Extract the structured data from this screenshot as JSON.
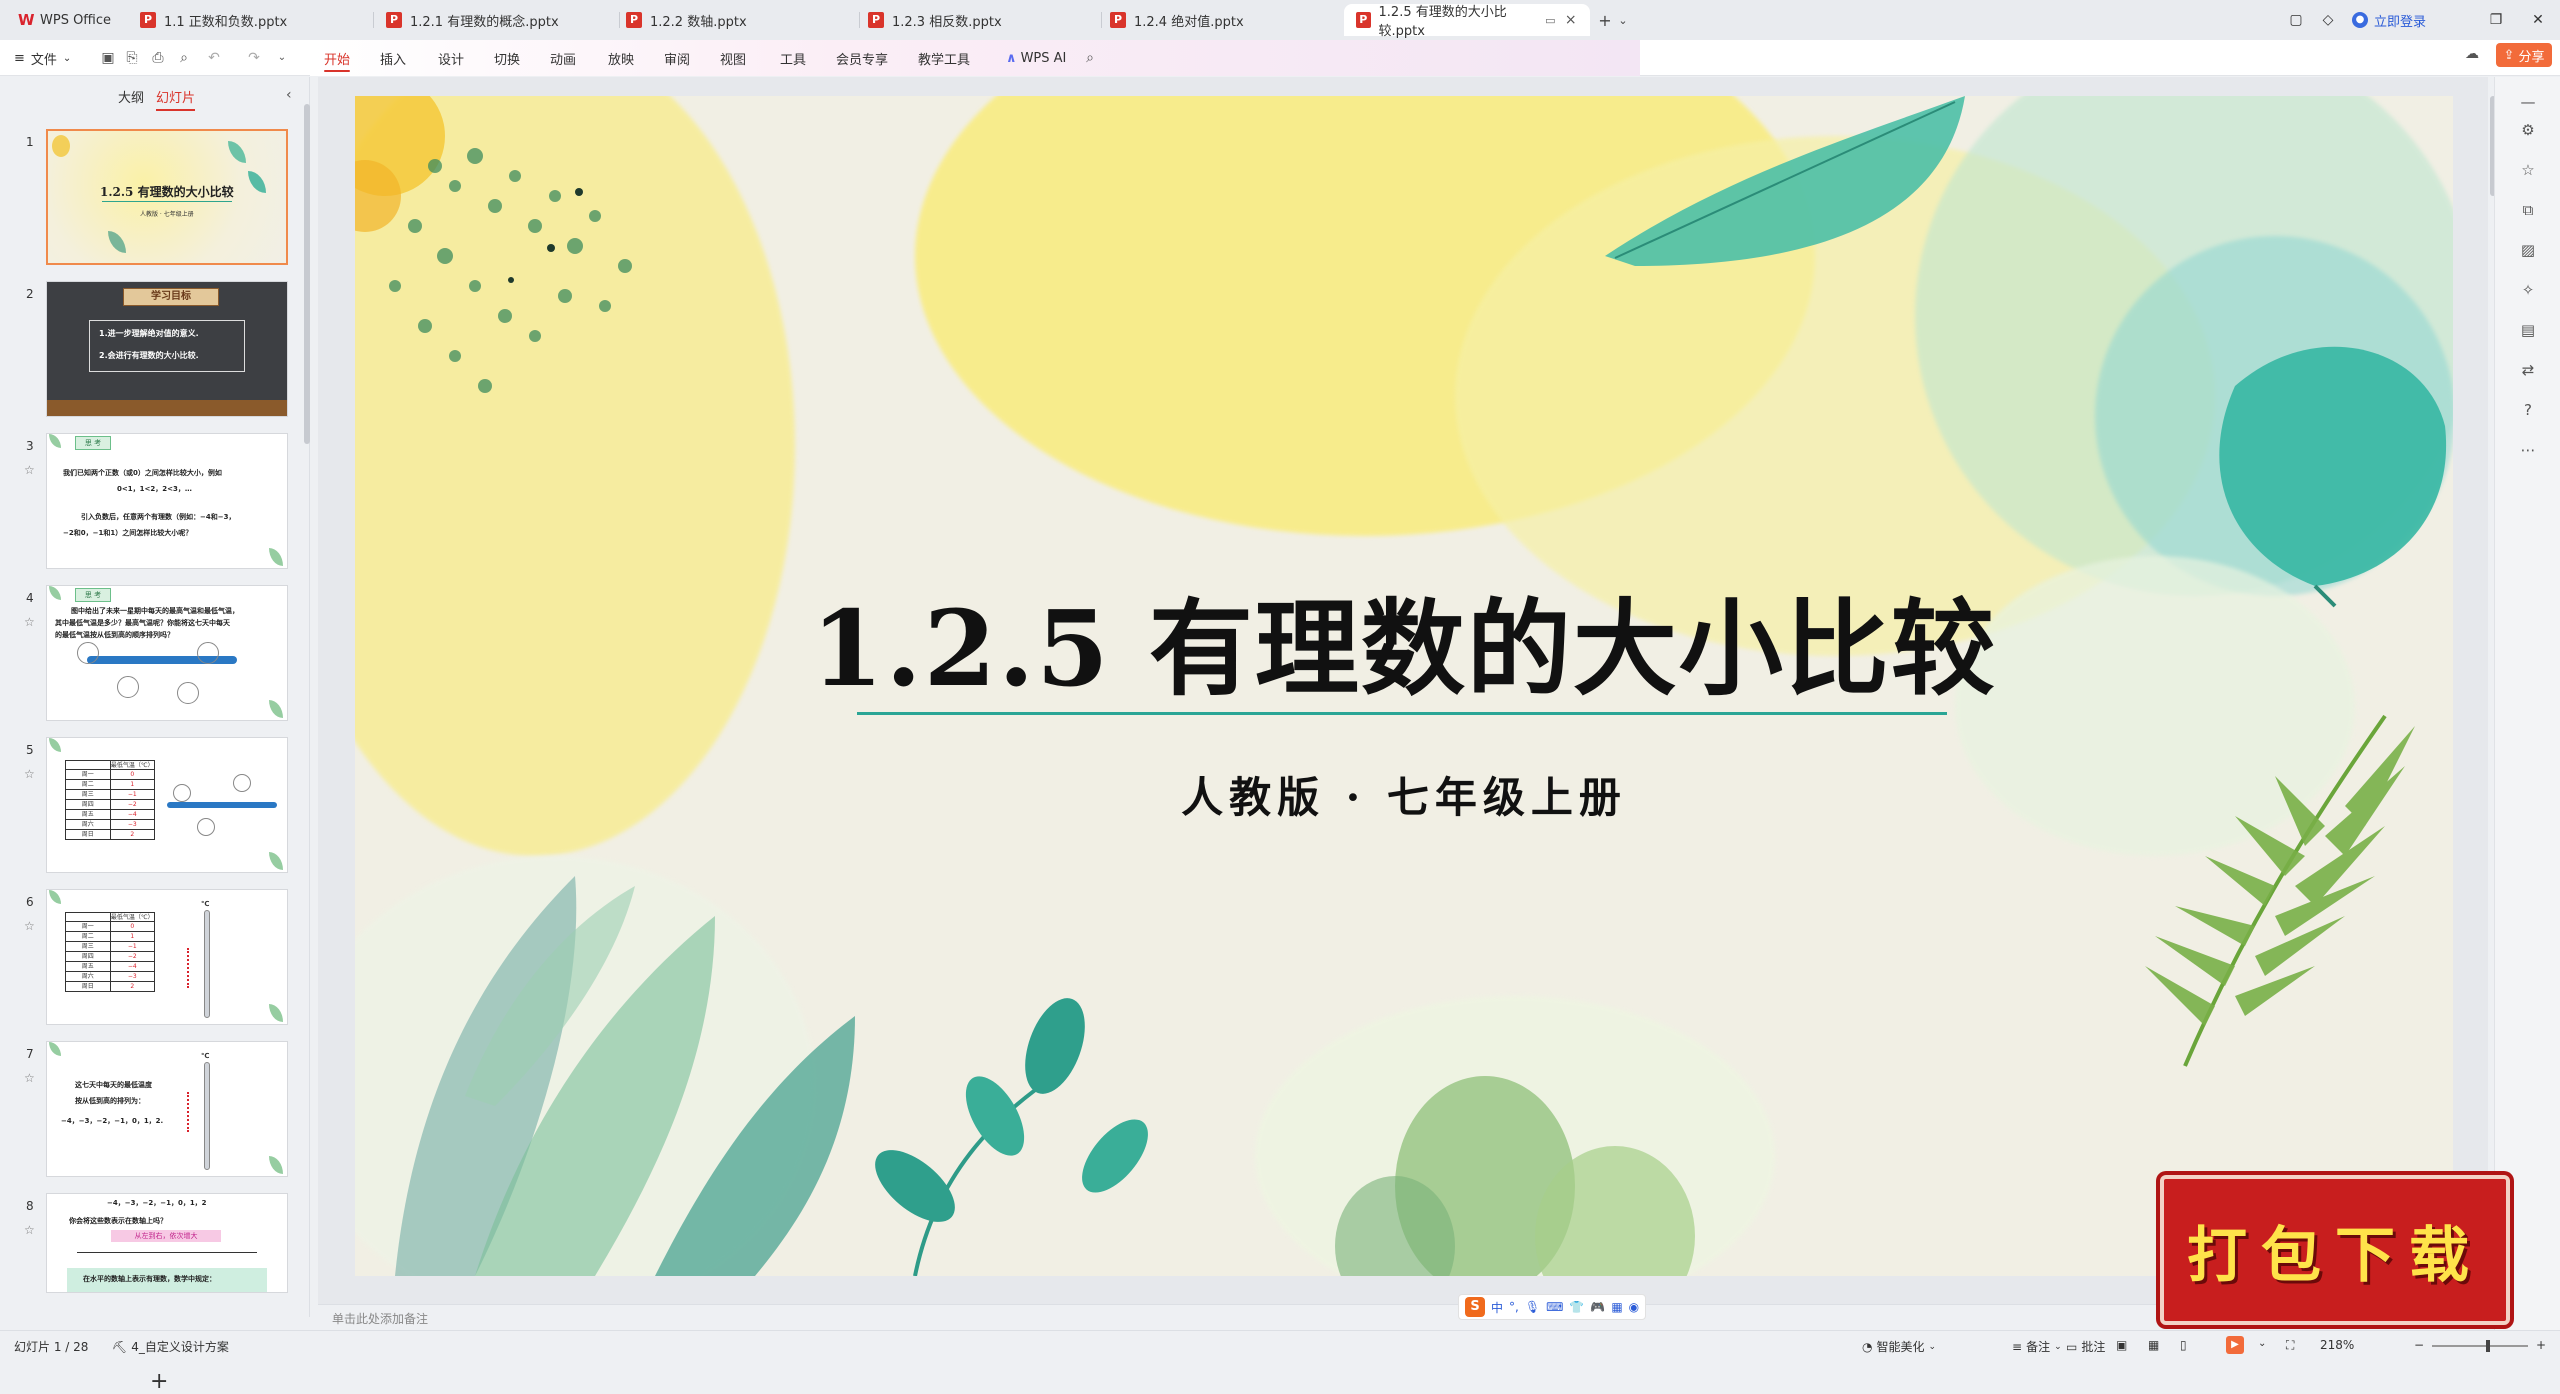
{
  "app": {
    "name": "WPS Office"
  },
  "tabs": [
    {
      "label": "1.1 正数和负数.pptx"
    },
    {
      "label": "1.2.1 有理数的概念.pptx"
    },
    {
      "label": "1.2.2 数轴.pptx"
    },
    {
      "label": "1.2.3 相反数.pptx"
    },
    {
      "label": "1.2.4 绝对值.pptx"
    },
    {
      "label": "1.2.5 有理数的大小比较.pptx",
      "active": true
    }
  ],
  "header": {
    "login_label": "立即登录",
    "share_label": "分享"
  },
  "ribbon": {
    "file_label": "文件",
    "tabs": [
      "开始",
      "插入",
      "设计",
      "切换",
      "动画",
      "放映",
      "审阅",
      "视图",
      "工具",
      "会员专享",
      "教学工具"
    ],
    "wps_ai_label": "WPS AI"
  },
  "left_panel": {
    "tab_outline": "大纲",
    "tab_slides": "幻灯片",
    "thumbnails": [
      {
        "num": "1",
        "title": "1.2.5 有理数的大小比较",
        "sub": "人教版 · 七年级上册"
      },
      {
        "num": "2",
        "header": "学习目标",
        "line1": "1.进一步理解绝对值的意义.",
        "line2": "2.会进行有理数的大小比较."
      },
      {
        "num": "3",
        "label": "思 考",
        "line1": "我们已知两个正数（或0）之间怎样比较大小，例如",
        "line2": "0<1，1<2，2<3，…",
        "line3": "引入负数后，任意两个有理数（例如：−4和−3，",
        "line4": "−2和0，−1和1）之间怎样比较大小呢？"
      },
      {
        "num": "4",
        "label": "思 考",
        "line1": "图中给出了未来一星期中每天的最高气温和最低气温，",
        "line2": "其中最低气温是多少？最高气温呢？你能将这七天中每天",
        "line3": "的最低气温按从低到高的顺序排列吗？",
        "highlight": "从低到高"
      },
      {
        "num": "5",
        "table_header": "最低气温（℃）",
        "rows": [
          [
            "周一",
            "0"
          ],
          [
            "周二",
            "1"
          ],
          [
            "周三",
            "−1"
          ],
          [
            "周四",
            "−2"
          ],
          [
            "周五",
            "−4"
          ],
          [
            "周六",
            "−3"
          ],
          [
            "周日",
            "2"
          ]
        ]
      },
      {
        "num": "6",
        "table_header": "最低气温（℃）",
        "unit": "℃",
        "rows": [
          [
            "周一",
            "0"
          ],
          [
            "周二",
            "1"
          ],
          [
            "周三",
            "−1"
          ],
          [
            "周四",
            "−2"
          ],
          [
            "周五",
            "−4"
          ],
          [
            "周六",
            "−3"
          ],
          [
            "周日",
            "2"
          ]
        ]
      },
      {
        "num": "7",
        "unit": "℃",
        "line1": "这七天中每天的最低温度",
        "line2": "按从低到高的排列为：",
        "line3": "−4，−3，−2，−1，0，1，2."
      },
      {
        "num": "8",
        "line1": "−4，−3，−2，−1，0，1，2",
        "line2": "你会将这些数表示在数轴上吗？",
        "pink": "从左到右，依次增大",
        "line3": "在水平的数轴上表示有理数，数学中规定："
      }
    ],
    "add_label": "+"
  },
  "slide": {
    "title": "1.2.5 有理数的大小比较",
    "subtitle": "人教版 · 七年级上册"
  },
  "notes": {
    "placeholder": "单击此处添加备注"
  },
  "ime": {
    "logo": "S",
    "lang": "中"
  },
  "download_badge": {
    "label": "打包下载"
  },
  "status": {
    "slide_counter": "幻灯片 1 / 28",
    "theme": "4_自定义设计方案",
    "smart_beautify": "智能美化",
    "notes": "备注",
    "comments": "批注",
    "zoom": "218%"
  },
  "colors": {
    "accent": "#d9342b",
    "share": "#f26b3a",
    "title_line": "#2aa595",
    "badge": "#c81e1e"
  }
}
